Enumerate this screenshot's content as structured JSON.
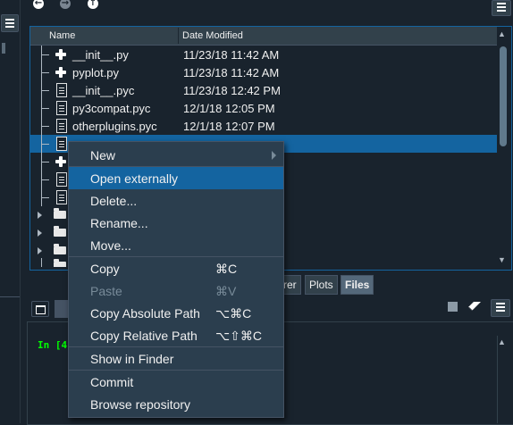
{
  "files": {
    "columns": {
      "name": "Name",
      "date": "Date Modified"
    },
    "rows": [
      {
        "name": "__init__.py",
        "date": "11/23/18 11:42 AM",
        "icon": "python-file-icon"
      },
      {
        "name": "pyplot.py",
        "date": "11/23/18 11:42 AM",
        "icon": "python-file-icon"
      },
      {
        "name": "__init__.pyc",
        "date": "11/23/18 12:42 PM",
        "icon": "compiled-file-icon"
      },
      {
        "name": "py3compat.pyc",
        "date": "12/1/18 12:05 PM",
        "icon": "compiled-file-icon"
      },
      {
        "name": "otherplugins.pyc",
        "date": "12/1/18 12:07 PM",
        "icon": "compiled-file-icon"
      }
    ]
  },
  "tabs": [
    {
      "label": "rer",
      "active": false
    },
    {
      "label": "Plots",
      "active": false
    },
    {
      "label": "Files",
      "active": true
    }
  ],
  "console": {
    "prompt": "In [4"
  },
  "context_menu": {
    "items": [
      {
        "label": "New",
        "shortcut": "",
        "submenu": true,
        "disabled": false,
        "highlighted": false
      },
      {
        "label": "Open externally",
        "shortcut": "",
        "disabled": false,
        "highlighted": true
      },
      {
        "label": "Delete...",
        "shortcut": "",
        "disabled": false,
        "highlighted": false
      },
      {
        "label": "Rename...",
        "shortcut": "",
        "disabled": false,
        "highlighted": false
      },
      {
        "label": "Move...",
        "shortcut": "",
        "disabled": false,
        "highlighted": false
      },
      {
        "label": "Copy",
        "shortcut": "⌘C",
        "disabled": false,
        "highlighted": false
      },
      {
        "label": "Paste",
        "shortcut": "⌘V",
        "disabled": true,
        "highlighted": false
      },
      {
        "label": "Copy Absolute Path",
        "shortcut": "⌥⌘C",
        "disabled": false,
        "highlighted": false
      },
      {
        "label": "Copy Relative Path",
        "shortcut": "⌥⇧⌘C",
        "disabled": false,
        "highlighted": false
      },
      {
        "label": "Show in Finder",
        "shortcut": "",
        "disabled": false,
        "highlighted": false
      },
      {
        "label": "Commit",
        "shortcut": "",
        "disabled": false,
        "highlighted": false
      },
      {
        "label": "Browse repository",
        "shortcut": "",
        "disabled": false,
        "highlighted": false
      }
    ]
  },
  "colors": {
    "background": "#19232d",
    "accent": "#1464a0",
    "panel": "#32414b",
    "prompt": "#00ff00"
  }
}
